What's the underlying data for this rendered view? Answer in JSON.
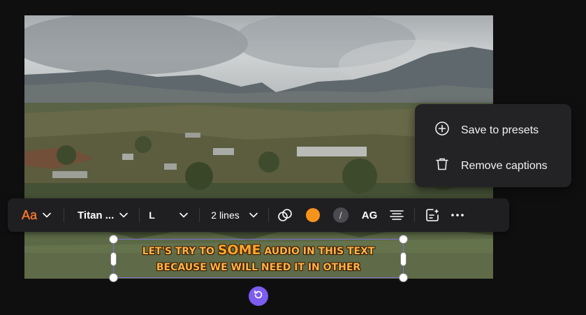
{
  "toolbar": {
    "font_style_icon_label": "Aa",
    "font_name": "Titan ...",
    "size_label": "L",
    "lines_label": "2 lines",
    "text_case_label": "AG",
    "accent_color": "#f7931a"
  },
  "context_menu": {
    "items": [
      {
        "label": "Save to presets",
        "icon": "plus-circle-icon"
      },
      {
        "label": "Remove captions",
        "icon": "trash-icon"
      }
    ]
  },
  "caption": {
    "line1_pre": "LET'S TRY TO ",
    "line1_big": "SOME",
    "line1_post": " AUDIO IN THIS TEXT",
    "line2": "BECAUSE WE WILL NEED IT IN OTHER"
  }
}
